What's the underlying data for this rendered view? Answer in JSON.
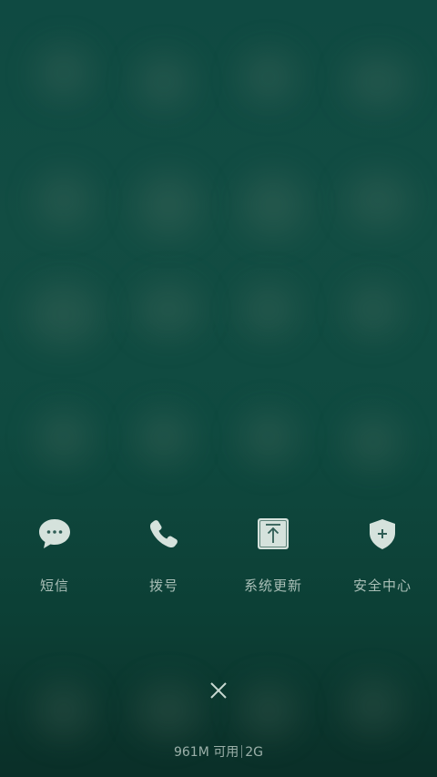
{
  "recents": {
    "apps": [
      {
        "label": "短信",
        "icon": "message-icon"
      },
      {
        "label": "拨号",
        "icon": "phone-icon"
      },
      {
        "label": "系统更新",
        "icon": "system-update-icon"
      },
      {
        "label": "安全中心",
        "icon": "security-shield-icon"
      }
    ]
  },
  "footer": {
    "memory_available": "961M 可用",
    "memory_total": "2G"
  },
  "colors": {
    "background": "#0f4a42",
    "icon": "#d5e2dc",
    "text": "#c8d8d1"
  }
}
